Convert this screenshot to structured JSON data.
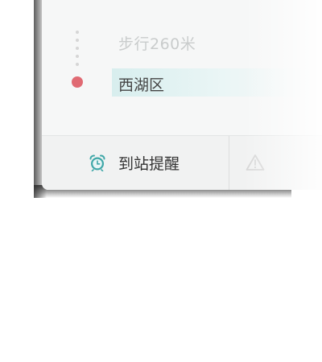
{
  "route": {
    "walk_text": "步行260米",
    "stop_name": "西湖区"
  },
  "actions": {
    "arrival_reminder_label": "到站提醒",
    "report_label": ""
  },
  "colors": {
    "accent_teal": "#3fa7a8",
    "stop_dot": "#e06a73",
    "highlight_row": "#d8eeee"
  },
  "icons": {
    "arrival": "alarm-clock-icon",
    "report": "warning-icon"
  }
}
